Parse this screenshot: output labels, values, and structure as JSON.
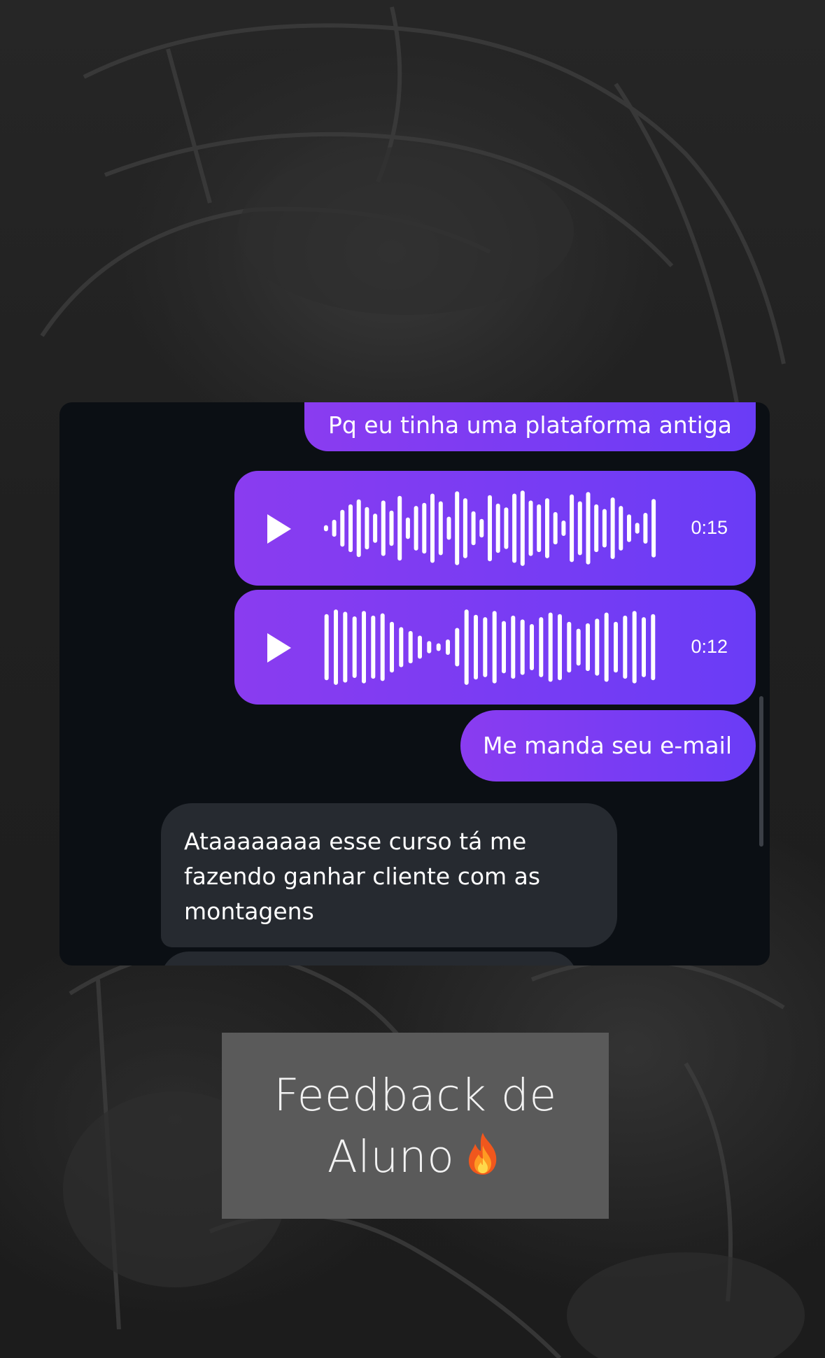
{
  "chat": {
    "messages": [
      {
        "direction": "outgoing",
        "type": "text",
        "text": "Pq eu tinha uma plataforma antiga"
      },
      {
        "direction": "outgoing",
        "type": "audio",
        "duration": "0:15"
      },
      {
        "direction": "outgoing",
        "type": "audio",
        "duration": "0:12"
      },
      {
        "direction": "outgoing",
        "type": "text",
        "text": "Me manda seu e-mail"
      },
      {
        "direction": "incoming",
        "type": "text",
        "text": "Ataaaaaaaa esse curso tá me fazendo ganhar cliente com as montagens"
      },
      {
        "direction": "incoming",
        "type": "text",
        "text": ""
      }
    ]
  },
  "caption": {
    "line1": "Feedback de",
    "line2": "Aluno"
  },
  "icons": {
    "play": "play-icon",
    "waveform": "waveform-icon",
    "fire": "fire-emoji-icon"
  },
  "colors": {
    "outgoing_bubble_start": "#8a3cf0",
    "outgoing_bubble_end": "#6a3cf6",
    "incoming_bubble": "#262a30",
    "chat_background": "#0b0f14",
    "caption_box": "#5a5a5a"
  }
}
